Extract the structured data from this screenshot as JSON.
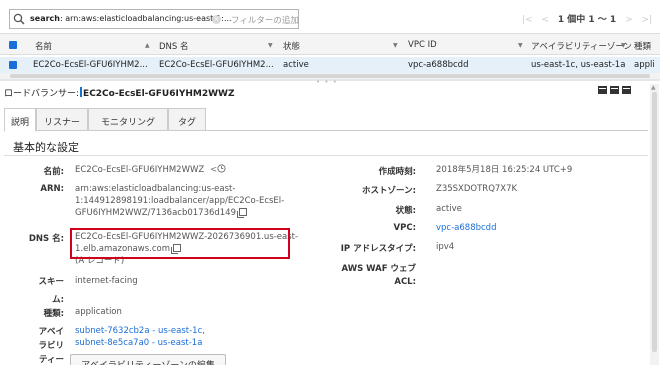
{
  "filter": {
    "search_key": "search",
    "search_value": ": arn:aws:elasticloadbalancing:us-east-1:...",
    "clear": "×",
    "add_filter": "フィルターの追加"
  },
  "pager": {
    "first": "|<",
    "prev": "<",
    "count": "1 個中 1 ～ 1",
    "next": ">",
    "last": ">|"
  },
  "table": {
    "columns": [
      "名前",
      "DNS 名",
      "状態",
      "VPC ID",
      "アベイラビリティーゾーン",
      "種類"
    ],
    "sort_indicator": "▲",
    "dropdown_indicator": "▼",
    "row": {
      "name": "EC2Co-EcsEl-GFU6IYHM2...",
      "dns": "EC2Co-EcsEl-GFU6IYHM2...",
      "state": "active",
      "vpc": "vpc-a688bcdd",
      "az": "us-east-1c, us-east-1a",
      "type": "appli"
    }
  },
  "detail": {
    "prefix": "ロードバランサー:",
    "name": "EC2Co-EcsEl-GFU6IYHM2WWZ",
    "tabs": [
      "説明",
      "リスナー",
      "モニタリング",
      "タグ"
    ],
    "section_title": "基本的な設定",
    "left": {
      "name_label": "名前:",
      "name_value": "EC2Co-EcsEl-GFU6IYHM2WWZ",
      "arn_label": "ARN:",
      "arn_line1": "arn:aws:elasticloadbalancing:us-east-",
      "arn_line2": "1:144912898191:loadbalancer/app/EC2Co-EcsEl-",
      "arn_line3": "GFU6IYHM2WWZ/7136acb01736d149",
      "dns_label": "DNS 名:",
      "dns_line1": "EC2Co-EcsEl-GFU6IYHM2WWZ-2026736901.us-east-",
      "dns_line2": "1.elb.amazonaws.com",
      "dns_record": "(A レコード)",
      "scheme_label_1": "スキー",
      "scheme_label_2": "ム:",
      "scheme_value": "internet-facing",
      "type_label": "種類:",
      "type_value": "application",
      "az_label_1": "アベイ",
      "az_label_2": "ラビリ",
      "az_label_3": "ティー",
      "az_subnet1": "subnet-7632cb2a - us-east-1c,",
      "az_subnet2": "subnet-8e5ca7a0 - us-east-1a",
      "az_button": "アベイラビリティーゾーンの編集"
    },
    "right": {
      "created_label": "作成時刻:",
      "created_value": "2018年5月18日 16:25:24 UTC+9",
      "hostzone_label": "ホストゾーン:",
      "hostzone_value": "Z35SXDOTRQ7X7K",
      "state_label": "状態:",
      "state_value": "active",
      "vpc_label": "VPC:",
      "vpc_value": "vpc-a688bcdd",
      "ip_label": "IP アドレスタイプ:",
      "ip_value": "ipv4",
      "waf_label_1": "AWS WAF ウェブ",
      "waf_label_2": "ACL:"
    }
  },
  "colors": {
    "accent": "#1a6ed8",
    "highlight": "#d0021b",
    "selected_row": "#e5f0f9"
  }
}
